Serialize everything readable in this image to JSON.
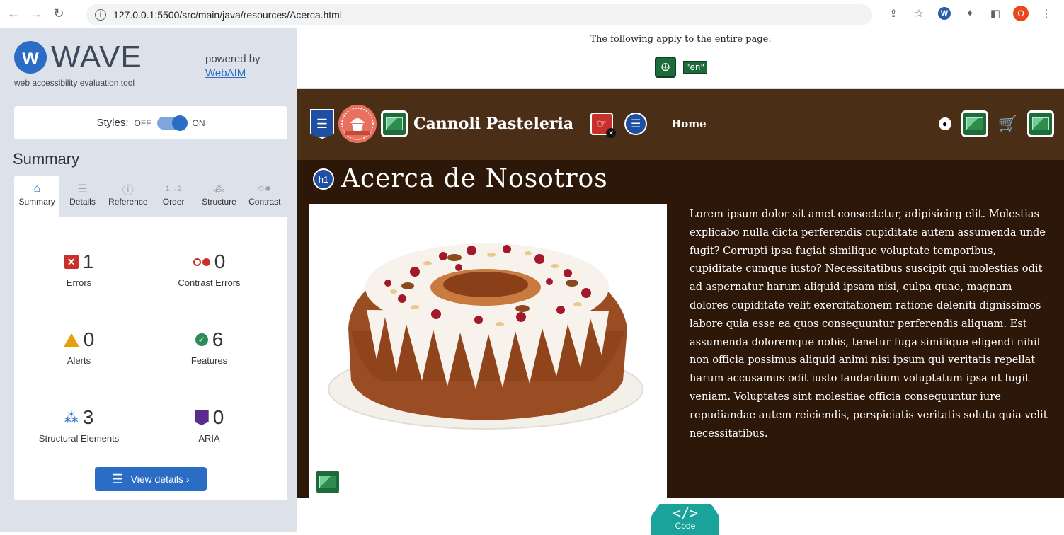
{
  "browser": {
    "url": "127.0.0.1:5500/src/main/java/resources/Acerca.html",
    "profile_initial": "O"
  },
  "wave": {
    "logo_text": "WAVE",
    "tagline": "web accessibility evaluation tool",
    "powered_by": "powered by",
    "powered_link": "WebAIM",
    "styles_label": "Styles:",
    "styles_off": "OFF",
    "styles_on": "ON",
    "summary_heading": "Summary",
    "tabs": [
      {
        "label": "Summary",
        "icon": "home-icon"
      },
      {
        "label": "Details",
        "icon": "list-icon"
      },
      {
        "label": "Reference",
        "icon": "info-icon"
      },
      {
        "label": "Order",
        "icon": "order-icon"
      },
      {
        "label": "Structure",
        "icon": "structure-icon"
      },
      {
        "label": "Contrast",
        "icon": "contrast-icon"
      }
    ],
    "stats": {
      "errors": {
        "count": "1",
        "label": "Errors"
      },
      "contrast_errors": {
        "count": "0",
        "label": "Contrast Errors"
      },
      "alerts": {
        "count": "0",
        "label": "Alerts"
      },
      "features": {
        "count": "6",
        "label": "Features"
      },
      "structural": {
        "count": "3",
        "label": "Structural Elements"
      },
      "aria": {
        "count": "0",
        "label": "ARIA"
      }
    },
    "view_details": "View details ›",
    "colors": {
      "accent": "#2b6cc4",
      "error": "#c9302c",
      "alert": "#e5a00d",
      "feature": "#2e8b57",
      "aria": "#5b2c8f"
    }
  },
  "page": {
    "apply_note": "The following apply to the entire page:",
    "lang_tag": "\"en\"",
    "brand": "Cannoli Pasteleria",
    "nav_home": "Home",
    "heading_badge": "h1",
    "heading": "Acerca de Nosotros",
    "paragraph": "Lorem ipsum dolor sit amet consectetur, adipisicing elit. Molestias explicabo nulla dicta perferendis cupiditate autem assumenda unde fugit? Corrupti ipsa fugiat similique voluptate temporibus, cupiditate cumque iusto? Necessitatibus suscipit qui molestias odit ad aspernatur harum aliquid ipsam nisi, culpa quae, magnam dolores cupiditate velit exercitationem ratione deleniti dignissimos labore quia esse ea quos consequuntur perferendis aliquam. Est assumenda doloremque nobis, tenetur fuga similique eligendi nihil non officia possimus aliquid animi nisi ipsum qui veritatis repellat harum accusamus odit iusto laudantium voluptatum ipsa ut fugit veniam. Voluptates sint molestiae officia consequuntur iure repudiandae autem reiciendis, perspiciatis veritatis soluta quia velit necessitatibus.",
    "code_label": "Code",
    "colors": {
      "header_bg": "#4a2e16",
      "content_bg": "#2d1708"
    }
  }
}
